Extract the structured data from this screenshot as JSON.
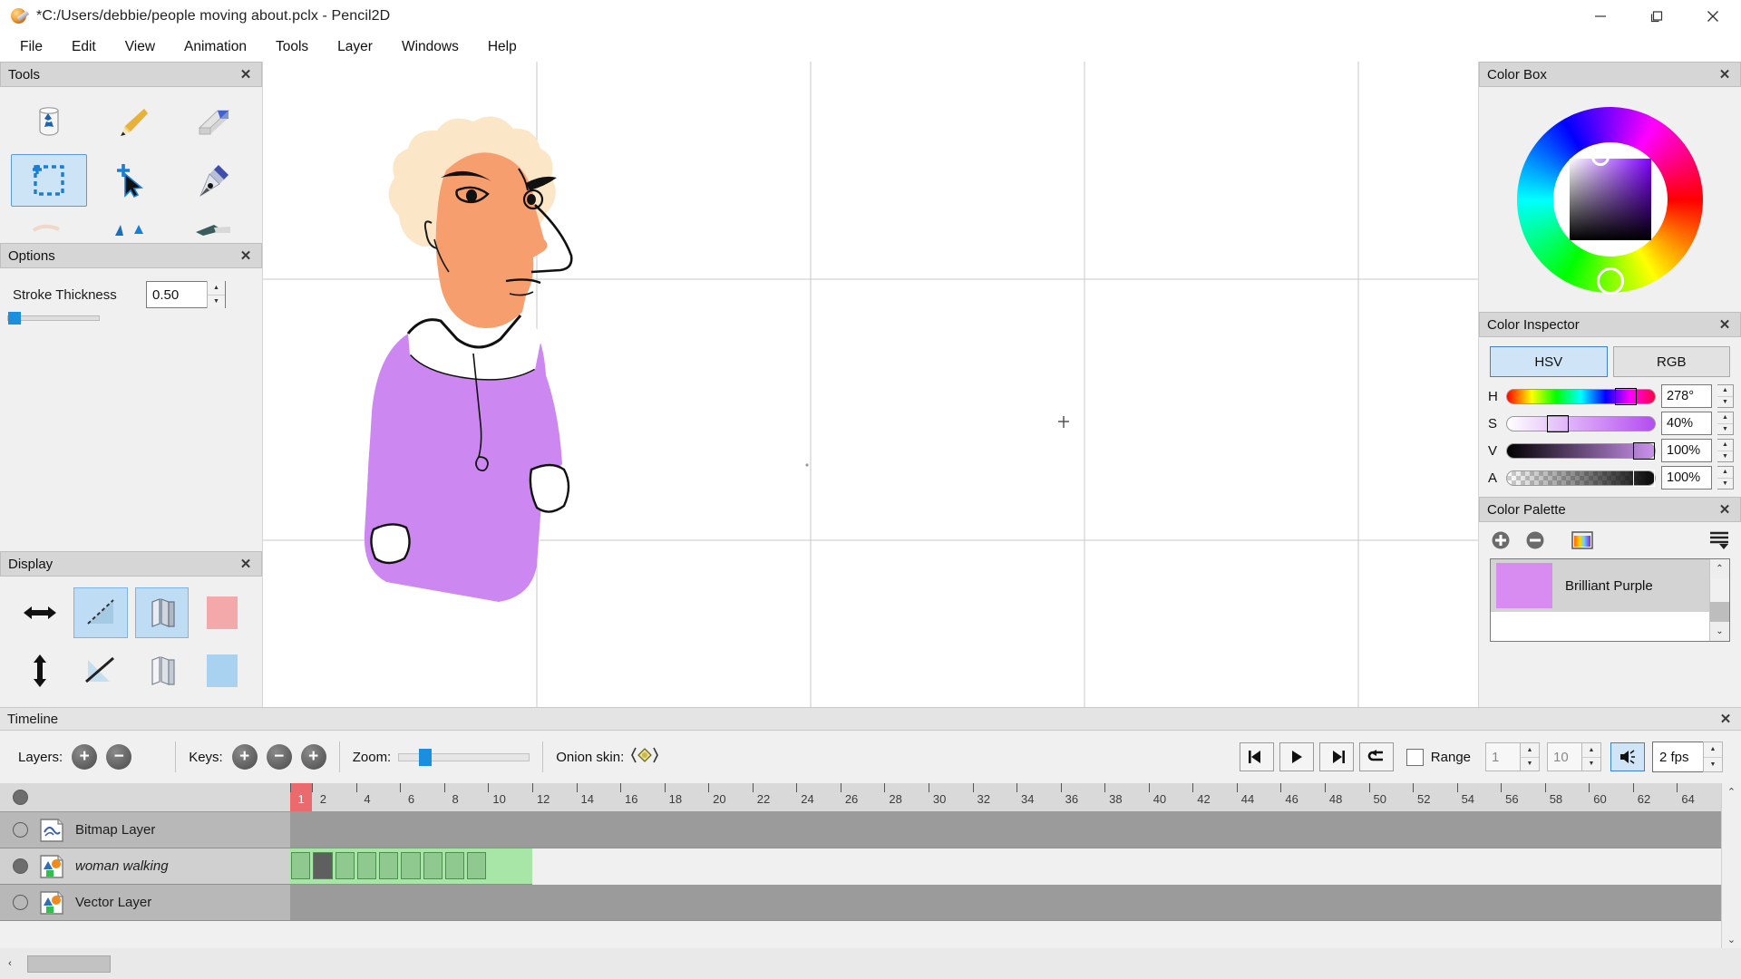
{
  "window": {
    "title": "*C:/Users/debbie/people moving about.pclx - Pencil2D",
    "app_icon": "pencil2d-logo-icon",
    "minimize": "—",
    "maximize": "❐",
    "close": "✕"
  },
  "menubar": {
    "items": [
      "File",
      "Edit",
      "View",
      "Animation",
      "Tools",
      "Layer",
      "Windows",
      "Help"
    ]
  },
  "panels": {
    "tools": {
      "title": "Tools",
      "close": "✕"
    },
    "options": {
      "title": "Options",
      "close": "✕"
    },
    "display": {
      "title": "Display",
      "close": "✕"
    },
    "color_box": {
      "title": "Color Box",
      "close": "✕"
    },
    "color_inspector": {
      "title": "Color Inspector",
      "close": "✕"
    },
    "color_palette": {
      "title": "Color Palette",
      "close": "✕"
    },
    "timeline": {
      "title": "Timeline",
      "close": "✕"
    }
  },
  "tools": {
    "items": [
      {
        "name": "bucket-tool-icon",
        "label": "Bucket",
        "selected": false
      },
      {
        "name": "pencil-tool-icon",
        "label": "Pencil",
        "selected": false
      },
      {
        "name": "eraser-tool-icon",
        "label": "Eraser",
        "selected": false
      },
      {
        "name": "select-tool-icon",
        "label": "Select",
        "selected": true
      },
      {
        "name": "move-tool-icon",
        "label": "Move",
        "selected": false
      },
      {
        "name": "pen-tool-icon",
        "label": "Pen",
        "selected": false
      },
      {
        "name": "smudge-tool-icon",
        "label": "Smudge",
        "selected": false
      },
      {
        "name": "polyline-tool-icon",
        "label": "Polyline",
        "selected": false
      },
      {
        "name": "brush-tool-icon",
        "label": "Brush",
        "selected": false
      }
    ]
  },
  "options": {
    "stroke_thickness_label": "Stroke Thickness",
    "stroke_thickness_value": "0.50",
    "slider_percent": 4
  },
  "display": {
    "buttons": [
      {
        "name": "flip-horizontal-icon",
        "selected": false
      },
      {
        "name": "onion-previous-icon",
        "selected": true
      },
      {
        "name": "mirror-view-icon",
        "selected": true
      },
      {
        "name": "onion-red-tint-icon",
        "selected": false
      },
      {
        "name": "flip-vertical-icon",
        "selected": false
      },
      {
        "name": "onion-next-icon",
        "selected": false
      },
      {
        "name": "mirror-view-vertical-icon",
        "selected": false
      },
      {
        "name": "onion-blue-tint-icon",
        "selected": false
      }
    ],
    "red_swatch": "#f3a9a9",
    "blue_swatch": "#a8d2f0"
  },
  "color_inspector": {
    "tabs": [
      {
        "label": "HSV",
        "selected": true
      },
      {
        "label": "RGB",
        "selected": false
      }
    ],
    "channels": [
      {
        "label": "H",
        "value": "278°",
        "percent": 77
      },
      {
        "label": "S",
        "value": "40%",
        "percent": 40
      },
      {
        "label": "V",
        "value": "100%",
        "percent": 100
      },
      {
        "label": "A",
        "value": "100%",
        "percent": 100
      }
    ],
    "current_color": "#cb7ef2",
    "hue_hex": "#7f00ff"
  },
  "color_palette": {
    "add_label": "+",
    "remove_label": "−",
    "swatch_view_icon": "palette-grid-icon",
    "menu_icon": "hamburger-menu-icon",
    "swatches": [
      {
        "name": "Brilliant Purple",
        "color": "#d88bf0",
        "selected": true
      }
    ],
    "scroll_up": "⌃",
    "scroll_down": "⌄"
  },
  "canvas": {
    "drawing_title": "woman-walking-character-drawing",
    "colors": {
      "hair": "#fbe6c8",
      "skin": "#f79e6e",
      "shirt": "#cc88f0",
      "white": "#ffffff",
      "outline": "#000000"
    },
    "guide_color": "#c8c8c8",
    "cursor_mark": "+"
  },
  "timeline": {
    "keys_label": "Keys:",
    "zoom_label": "Zoom:",
    "zoom_percent": 22,
    "onion_label": "Onion skin:",
    "onion_icon": "onion-skin-icon",
    "key_buttons": [
      {
        "name": "add-key-button",
        "glyph": "+"
      },
      {
        "name": "remove-key-button",
        "glyph": "−"
      },
      {
        "name": "duplicate-key-button",
        "glyph": "+"
      }
    ],
    "playback": [
      {
        "name": "previous-frame-button",
        "glyph": "◀|"
      },
      {
        "name": "play-button",
        "glyph": "▶"
      },
      {
        "name": "next-frame-button",
        "glyph": "|▶"
      },
      {
        "name": "loop-button",
        "glyph": "↰"
      }
    ],
    "range_label": "Range",
    "range_checked": false,
    "range_start": "1",
    "range_end": "10",
    "sound_enabled": true,
    "sound_icon": "speaker-icon",
    "fps_value": "2 fps",
    "layers_label": "Layers:",
    "layer_add": "+",
    "layer_remove": "−",
    "ruler_max": 65,
    "ruler_labels": [
      1,
      2,
      4,
      6,
      8,
      10,
      12,
      14,
      16,
      18,
      20,
      22,
      24,
      26,
      28,
      30,
      32,
      34,
      36,
      38,
      40,
      42,
      44,
      46,
      48,
      50,
      52,
      54,
      56,
      58,
      60,
      62,
      64
    ],
    "current_frame": 1,
    "layers": [
      {
        "name": "Bitmap Layer",
        "type": "bitmap",
        "visible": false,
        "selected": false,
        "keyframes": []
      },
      {
        "name": "woman walking",
        "type": "vector",
        "visible": true,
        "selected": true,
        "keyframes": [
          1,
          2,
          3,
          4,
          5,
          6,
          7,
          8,
          9
        ],
        "track_end": 11
      },
      {
        "name": "Vector Layer",
        "type": "vector",
        "visible": false,
        "selected": false,
        "keyframes": []
      }
    ]
  }
}
